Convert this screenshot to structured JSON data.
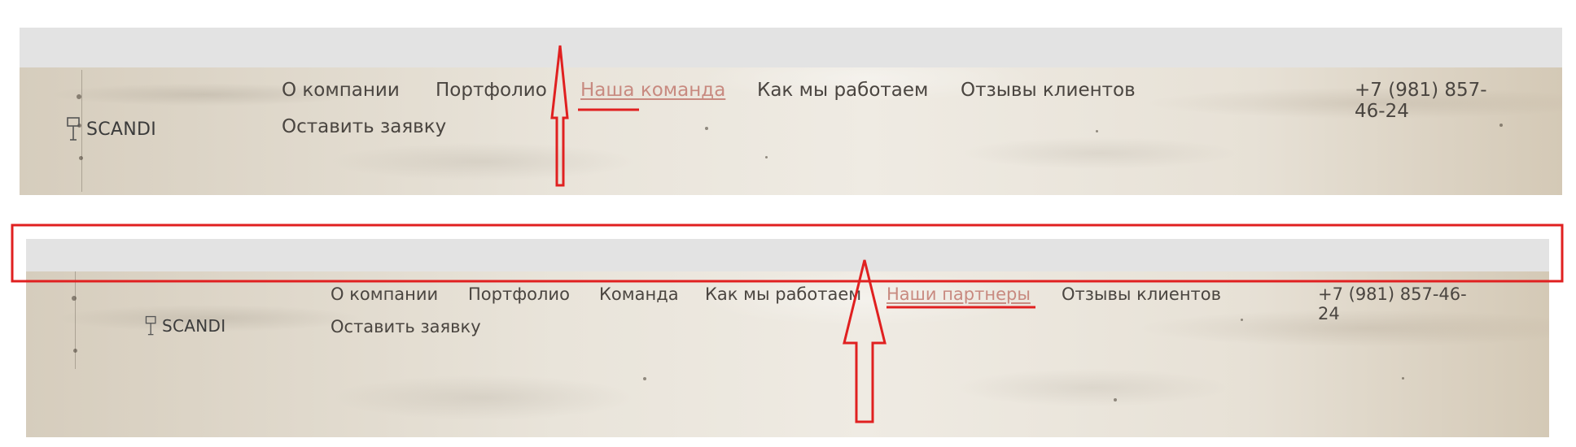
{
  "screenshots": [
    {
      "logo_text": "SCANDI",
      "nav_items": [
        {
          "label": "О компании",
          "active": false
        },
        {
          "label": "Портфолио",
          "active": false
        },
        {
          "label": "Наша команда",
          "active": true
        },
        {
          "label": "Как мы работаем",
          "active": false
        },
        {
          "label": "Отзывы клиентов",
          "active": false
        },
        {
          "label": "Оставить заявку",
          "active": false
        }
      ],
      "phone": "+7 (981) 857-46-24"
    },
    {
      "logo_text": "SCANDI",
      "nav_items": [
        {
          "label": "О компании",
          "active": false
        },
        {
          "label": "Портфолио",
          "active": false
        },
        {
          "label": "Команда",
          "active": false
        },
        {
          "label": "Как мы работаем",
          "active": false
        },
        {
          "label": "Наши партнеры",
          "active": true
        },
        {
          "label": "Отзывы клиентов",
          "active": false
        },
        {
          "label": "Оставить заявку",
          "active": false
        }
      ],
      "phone": "+7 (981) 857-46-24"
    }
  ],
  "annotation": {
    "color": "#e02020",
    "icons": [
      "arrow-up-icon",
      "arrow-up-icon",
      "highlight-rectangle",
      "underline-mark",
      "underline-mark"
    ]
  },
  "colors": {
    "active_link": "#c88a80",
    "nav_text": "#4a4540",
    "top_bar": "#e3e3e3"
  }
}
